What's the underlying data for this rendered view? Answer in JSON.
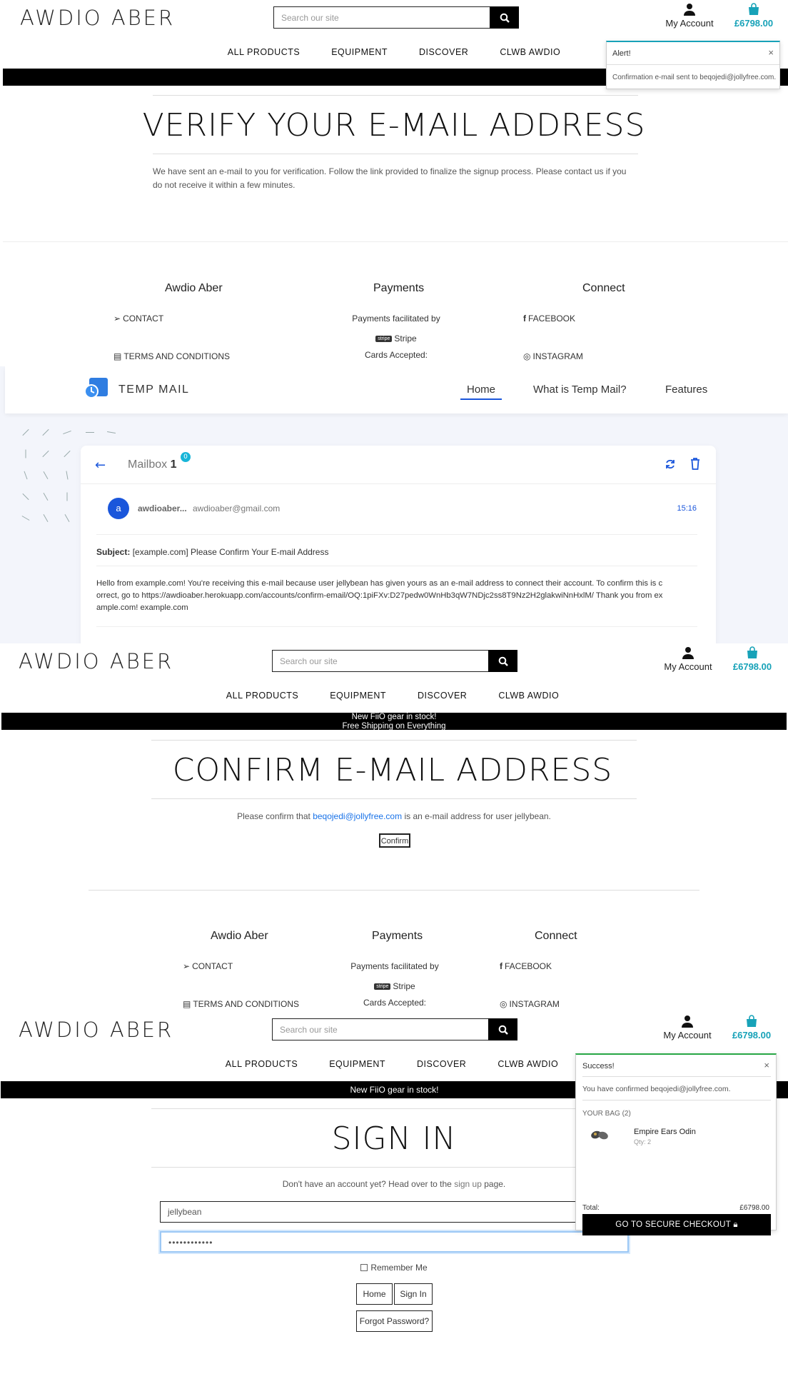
{
  "store": {
    "logo": "AWDIO ABER",
    "search_placeholder": "Search our site",
    "account_label": "My Account",
    "bag_total": "£6798.00",
    "nav": [
      "ALL PRODUCTS",
      "EQUIPMENT",
      "DISCOVER",
      "CLWB AWDIO"
    ],
    "banner_lines": [
      "New FiiO gear in stock!",
      "Free Shipping on Everything"
    ]
  },
  "verify_page": {
    "title": "VERIFY YOUR E-MAIL ADDRESS",
    "body": "We have sent an e-mail to you for verification. Follow the link provided to finalize the signup process. Please contact us if you do not receive it within a few minutes.",
    "alert_title": "Alert!",
    "alert_message": "Confirmation e-mail sent to beqojedi@jollyfree.com."
  },
  "footer": {
    "col1_title": "Awdio Aber",
    "col2_title": "Payments",
    "col3_title": "Connect",
    "contact": "CONTACT",
    "terms": "TERMS AND CONDITIONS",
    "payments_text": "Payments facilitated by",
    "stripe": "Stripe",
    "cards": "Cards Accepted:",
    "facebook": "FACEBOOK",
    "instagram": "INSTAGRAM"
  },
  "tempmail": {
    "brand": "TEMP MAIL",
    "nav": [
      "Home",
      "What is Temp Mail?",
      "Features"
    ],
    "mailbox_label": "Mailbox",
    "mailbox_count": "1",
    "badge": "0",
    "avatar_letter": "a",
    "sender_name": "awdioaber...",
    "sender_email": "awdioaber@gmail.com",
    "time": "15:16",
    "subject_label": "Subject:",
    "subject": "[example.com] Please Confirm Your E-mail Address",
    "body_lines": [
      "Hello from example.com! You're receiving this e-mail because user jellybean has given yours as an e-mail address to connect their account. To confirm this is c",
      "orrect, go to https://awdioaber.herokuapp.com/accounts/confirm-email/OQ:1piFXv:D27pedw0WnHb3qW7NDjc2ss8T9Nz2H2glakwiNnHxlM/ Thank you from ex",
      "ample.com! example.com"
    ]
  },
  "confirm_page": {
    "title": "CONFIRM E-MAIL ADDRESS",
    "text_before": "Please confirm that ",
    "email": "beqojedi@jollyfree.com",
    "text_after": " is an e-mail address for user jellybean.",
    "button": "Confirm"
  },
  "signin_page": {
    "title": "SIGN IN",
    "text_before": "Don't have an account yet? Head over to the ",
    "signup_link": "sign up",
    "text_after": " page.",
    "username_value": "jellybean",
    "password_value": "••••••••••••",
    "remember": "Remember Me",
    "home_btn": "Home",
    "signin_btn": "Sign In",
    "forgot_btn": "Forgot Password?",
    "success_title": "Success!",
    "success_msg": "You have confirmed beqojedi@jollyfree.com.",
    "bag_heading": "YOUR BAG (2)",
    "item_name": "Empire Ears Odin",
    "item_qty": "Qty: 2",
    "total_label": "Total:",
    "total_value": "£6798.00",
    "checkout": "GO TO SECURE CHECKOUT"
  },
  "colors": {
    "accent": "#17a2b8",
    "tm_blue": "#1a56db",
    "success": "#28a745"
  }
}
